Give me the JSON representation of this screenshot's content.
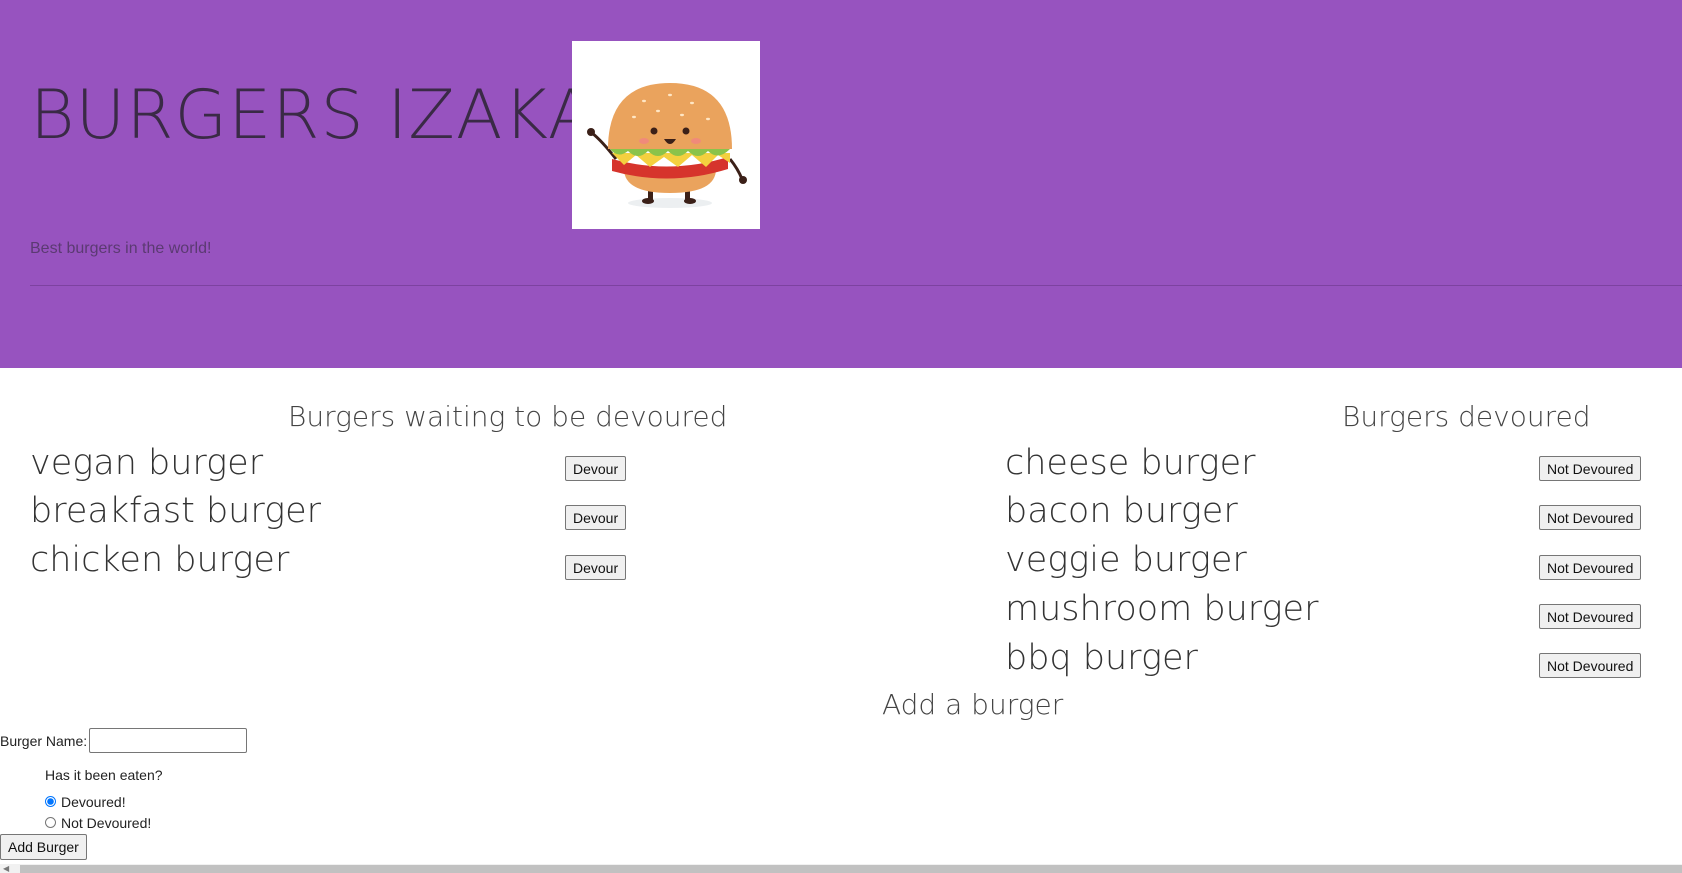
{
  "header": {
    "title": "BURGERS IZAKAYA",
    "tagline": "Best burgers in the world!",
    "logo_icon": "burger-mascot-icon"
  },
  "waiting": {
    "heading": "Burgers waiting to be devoured",
    "items": [
      {
        "name": "vegan burger",
        "button": "Devour"
      },
      {
        "name": "breakfast burger",
        "button": "Devour"
      },
      {
        "name": "chicken burger",
        "button": "Devour"
      }
    ]
  },
  "devoured": {
    "heading": "Burgers devoured",
    "items": [
      {
        "name": "cheese burger",
        "button": "Not Devoured"
      },
      {
        "name": "bacon burger",
        "button": "Not Devoured"
      },
      {
        "name": "veggie burger",
        "button": "Not Devoured"
      },
      {
        "name": "mushroom burger",
        "button": "Not Devoured"
      },
      {
        "name": "bbq burger",
        "button": "Not Devoured"
      }
    ]
  },
  "form": {
    "heading": "Add a burger",
    "name_label": "Burger Name:",
    "name_value": "",
    "eaten_question": "Has it been eaten?",
    "option_devoured": "Devoured!",
    "option_not_devoured": "Not Devoured!",
    "selected_option": "Devoured!",
    "submit_label": "Add Burger"
  },
  "colors": {
    "header_bg": "#9753bf"
  }
}
